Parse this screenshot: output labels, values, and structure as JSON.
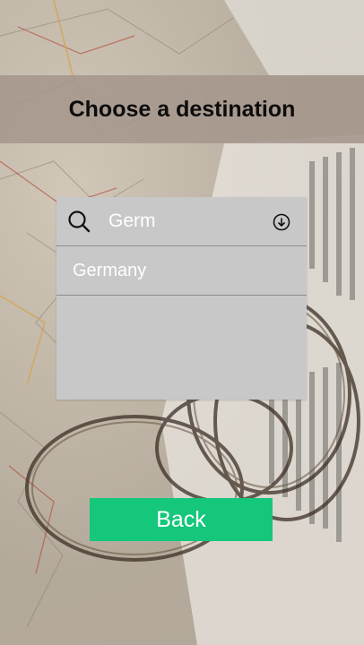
{
  "header": {
    "title": "Choose a destination"
  },
  "search": {
    "value": "Germ",
    "icon": "search-icon",
    "dropdown_icon": "chevron-down-circle-icon"
  },
  "suggestions": [
    {
      "label": "Germany"
    }
  ],
  "actions": {
    "back_label": "Back"
  },
  "colors": {
    "title_band": "#a5968c",
    "panel": "#c8c8c8",
    "back_button": "#14c77a",
    "text_light": "#ffffff"
  }
}
